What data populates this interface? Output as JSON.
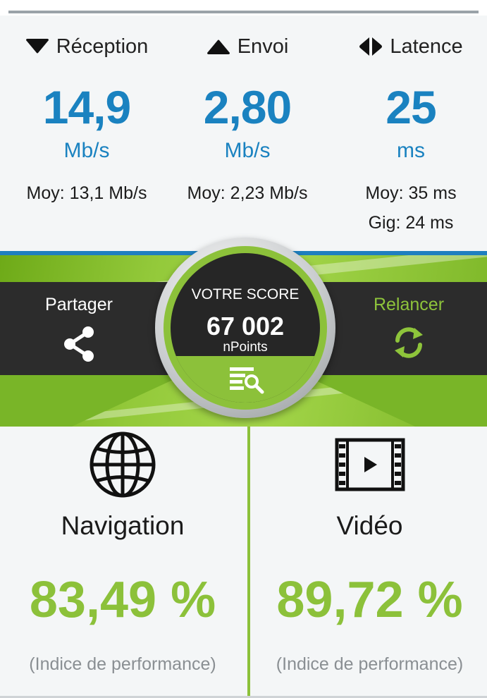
{
  "stats": {
    "reception": {
      "label": "Réception",
      "value": "14,9",
      "unit": "Mb/s",
      "average": "Moy: 13,1 Mb/s",
      "icon": "triangle-down-icon"
    },
    "upload": {
      "label": "Envoi",
      "value": "2,80",
      "unit": "Mb/s",
      "average": "Moy: 2,23 Mb/s",
      "icon": "triangle-up-icon"
    },
    "latency": {
      "label": "Latence",
      "value": "25",
      "unit": "ms",
      "average": "Moy: 35 ms",
      "peak": "Gig: 24 ms",
      "icon": "latency-arrows-icon"
    }
  },
  "actions": {
    "share_label": "Partager",
    "share_icon": "share-icon",
    "retry_label": "Relancer",
    "retry_icon": "refresh-icon"
  },
  "score": {
    "title": "VOTRE SCORE",
    "value": "67 002",
    "unit": "nPoints",
    "icon": "details-search-icon"
  },
  "panels": [
    {
      "name": "Navigation",
      "value": "83,49 %",
      "note": "(Indice de performance)",
      "icon": "globe-icon"
    },
    {
      "name": "Vidéo",
      "value": "89,72 %",
      "note": "(Indice de performance)",
      "icon": "film-play-icon"
    }
  ],
  "colors": {
    "accent_blue": "#1a82c0",
    "accent_green": "#8cc13a",
    "dark": "#2c2c2c"
  }
}
